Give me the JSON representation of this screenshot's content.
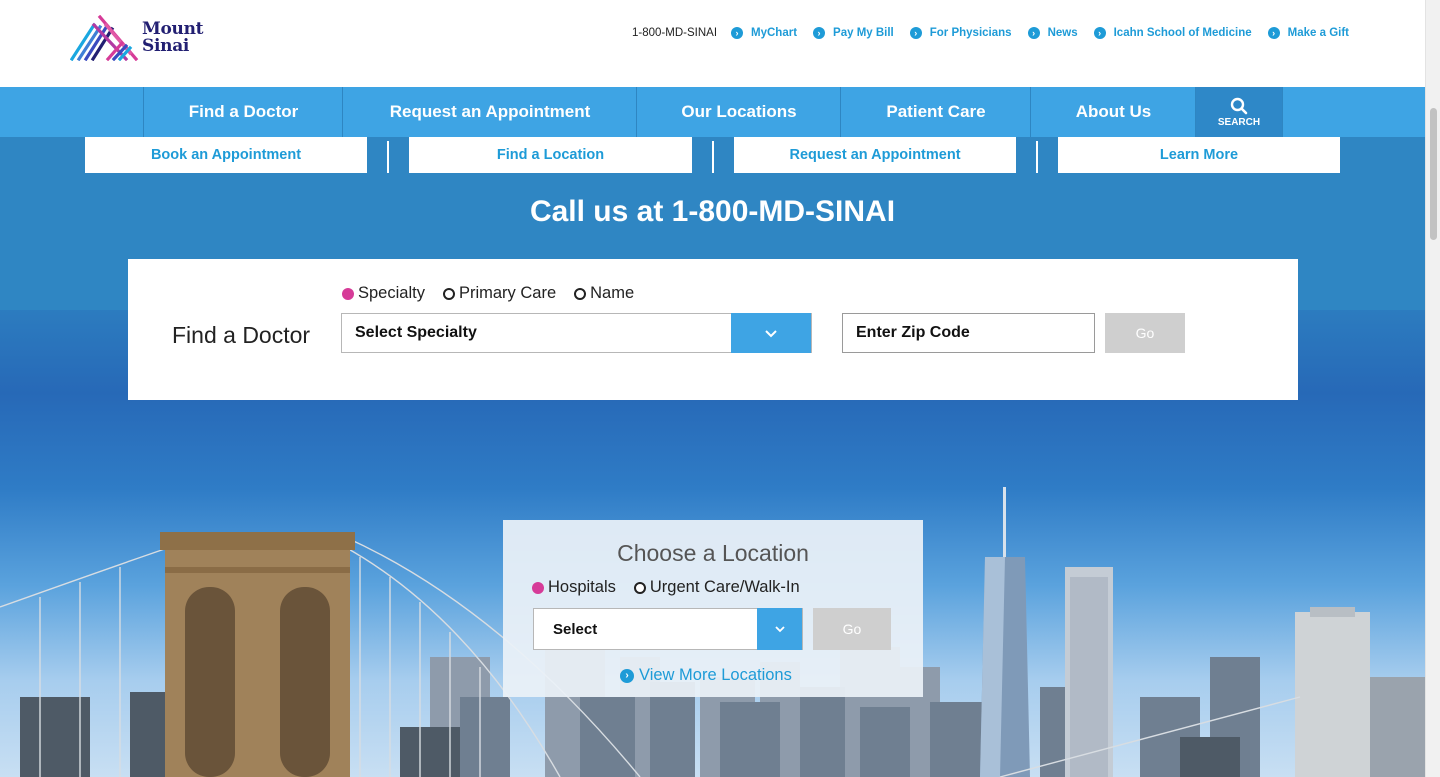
{
  "header": {
    "logo_text_line1": "Mount",
    "logo_text_line2": "Sinai",
    "phone": "1-800-MD-SINAI",
    "utility_links": [
      "MyChart",
      "Pay My Bill",
      "For Physicians",
      "News",
      "Icahn School of Medicine",
      "Make a Gift"
    ]
  },
  "nav": {
    "items": [
      "Find a Doctor",
      "Request an Appointment",
      "Our Locations",
      "Patient Care",
      "About Us"
    ],
    "search_label": "SEARCH"
  },
  "quick_links": [
    "Book an Appointment",
    "Find a Location",
    "Request an Appointment",
    "Learn More"
  ],
  "call_text": "Call us at 1-800-MD-SINAI",
  "find_doctor": {
    "title": "Find a Doctor",
    "options": [
      {
        "label": "Specialty",
        "selected": true
      },
      {
        "label": "Primary Care",
        "selected": false
      },
      {
        "label": "Name",
        "selected": false
      }
    ],
    "select_value": "Select Specialty",
    "zip_placeholder": "Enter Zip Code",
    "go_label": "Go"
  },
  "location": {
    "title": "Choose a Location",
    "options": [
      {
        "label": "Hospitals",
        "selected": true
      },
      {
        "label": "Urgent Care/Walk-In",
        "selected": false
      }
    ],
    "select_value": "Select",
    "go_label": "Go",
    "view_more": "View More Locations"
  },
  "colors": {
    "brand_blue": "#3ea4e4",
    "link_blue": "#1e9bd7",
    "radio_selected": "#d63b98",
    "logo_navy": "#221f72"
  }
}
